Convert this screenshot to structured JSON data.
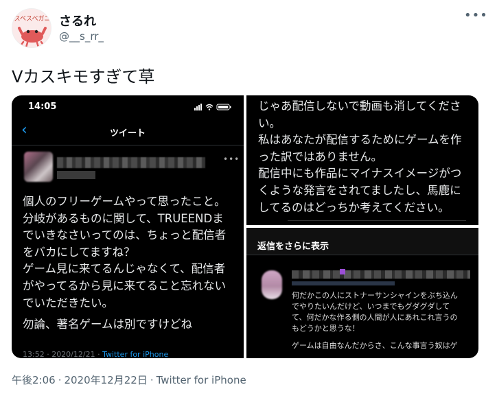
{
  "author": {
    "display_name": "さるれ",
    "handle": "@__s_rr_",
    "avatar_text": "スベスベガニ"
  },
  "tweet": {
    "text": "Vカスキモすぎて草",
    "time": "午後2:06",
    "date": "2020年12月22日",
    "separator": "·",
    "source": "Twitter for iPhone"
  },
  "screenshot_left": {
    "status_time": "14:05",
    "nav_title": "ツイート",
    "lines": [
      "個人のフリーゲームやって思ったこと。",
      "分岐があるものに関して、TRUEENDま",
      "でいきなさいってのは、ちょっと配信者",
      "をバカにしてますね？",
      "ゲーム見に来てるんじゃなくて、配信者",
      "がやってるから見に来てること忘れない",
      "でいただきたい。"
    ],
    "extra_line": "勿論、著名ゲームは別ですけどね",
    "meta_time": "13:52 · 2020/12/21 ·",
    "meta_source": "Twitter for iPhone"
  },
  "screenshot_top_right": {
    "lines": [
      "じゃあ配信しないで動画も消してくださ",
      "い。",
      "私はあなたが配信するためにゲームを作",
      "った訳ではありません。",
      "配信中にも作品にマイナスイメージがつ",
      "くような発言をされてましたし、馬鹿に",
      "してるのはどっちか考えてください。"
    ]
  },
  "screenshot_bottom_right": {
    "header": "返信をさらに表示",
    "lines": [
      "何だかこの人にストナーサンシャインをぶち込ん",
      "でやりたいんだけど、いつまでもグダグダして",
      "て、何だかな作る側の人間が人にあれこれ言うの",
      "もどうかと思うな！"
    ],
    "last_line": "ゲームは自由なんだからさ、こんな事言う奴はゲ"
  },
  "colors": {
    "link": "#1d9bf0",
    "muted": "#536471"
  }
}
